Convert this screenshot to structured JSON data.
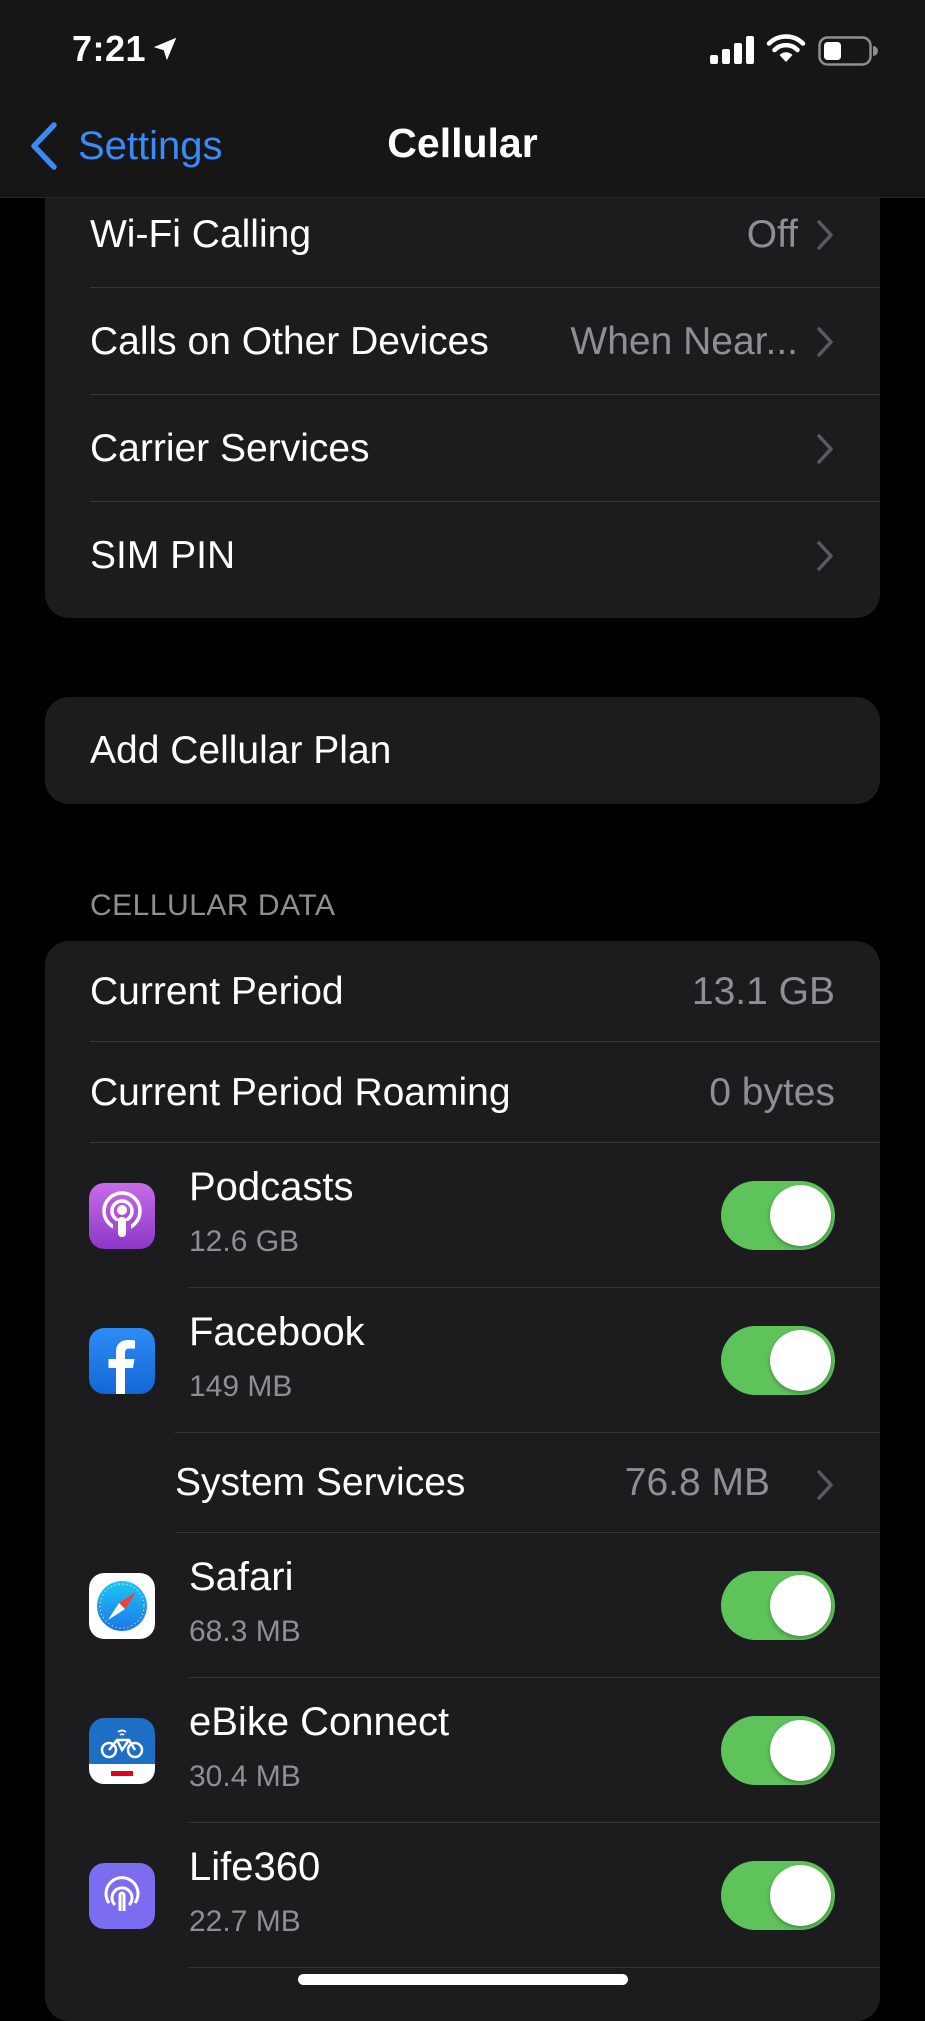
{
  "status_bar": {
    "time": "7:21"
  },
  "nav": {
    "back_label": "Settings",
    "title": "Cellular"
  },
  "group1": {
    "rows": [
      {
        "label": "Wi-Fi Calling",
        "value": "Off"
      },
      {
        "label": "Calls on Other Devices",
        "value": "When Near..."
      },
      {
        "label": "Carrier Services",
        "value": ""
      },
      {
        "label": "SIM PIN",
        "value": ""
      }
    ]
  },
  "add_plan": {
    "label": "Add Cellular Plan"
  },
  "cellular_data": {
    "header": "CELLULAR DATA",
    "current_period": {
      "label": "Current Period",
      "value": "13.1 GB"
    },
    "current_period_roaming": {
      "label": "Current Period Roaming",
      "value": "0 bytes"
    },
    "apps": [
      {
        "name": "Podcasts",
        "size": "12.6 GB",
        "icon": "podcasts-icon",
        "enabled": true
      },
      {
        "name": "Facebook",
        "size": "149 MB",
        "icon": "facebook-icon",
        "enabled": true
      }
    ],
    "system_services": {
      "label": "System Services",
      "value": "76.8 MB"
    },
    "apps2": [
      {
        "name": "Safari",
        "size": "68.3 MB",
        "icon": "safari-icon",
        "enabled": true
      },
      {
        "name": "eBike Connect",
        "size": "30.4 MB",
        "icon": "ebike-connect-icon",
        "enabled": true
      },
      {
        "name": "Life360",
        "size": "22.7 MB",
        "icon": "life360-icon",
        "enabled": true
      }
    ]
  },
  "colors": {
    "accent": "#3a8af7",
    "toggle_on": "#5ec35a",
    "cell_bg": "#1c1c1e",
    "secondary_text": "#8e8e93"
  }
}
